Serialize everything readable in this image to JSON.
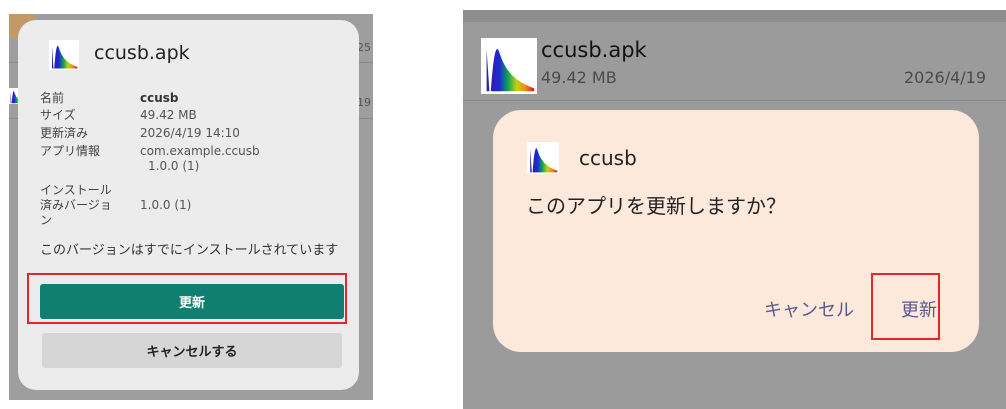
{
  "left": {
    "background": {
      "size_fragment": "25",
      "date_fragment": "19"
    },
    "dialog": {
      "title": "ccusb.apk",
      "rows": [
        {
          "label": "名前",
          "value": "ccusb"
        },
        {
          "label": "サイズ",
          "value": "49.42 MB"
        },
        {
          "label": "更新済み",
          "value": "2026/4/19 14:10"
        },
        {
          "label": "アプリ情報",
          "value": "com.example.ccusb",
          "value2": "1.0.0 (1)"
        },
        {
          "label_lines": [
            "インストール",
            "済みバージョ",
            "ン"
          ],
          "value": "1.0.0 (1)"
        }
      ],
      "message": "このバージョンはすでにインストールされています",
      "primary_button": "更新",
      "secondary_button": "キャンセルする"
    }
  },
  "right": {
    "background": {
      "file_name": "ccusb.apk",
      "file_size": "49.42 MB",
      "file_date": "2026/4/19"
    },
    "dialog": {
      "title": "ccusb",
      "message": "このアプリを更新しますか？",
      "cancel_button": "キャンセル",
      "update_button": "更新"
    }
  },
  "colors": {
    "highlight": "#e02a2a",
    "primary_button": "#107f71",
    "right_dialog_bg": "#fde8dc",
    "right_button_text": "#5b5a8c"
  },
  "icons": {
    "app_icon": "spectrum-chart-icon"
  }
}
